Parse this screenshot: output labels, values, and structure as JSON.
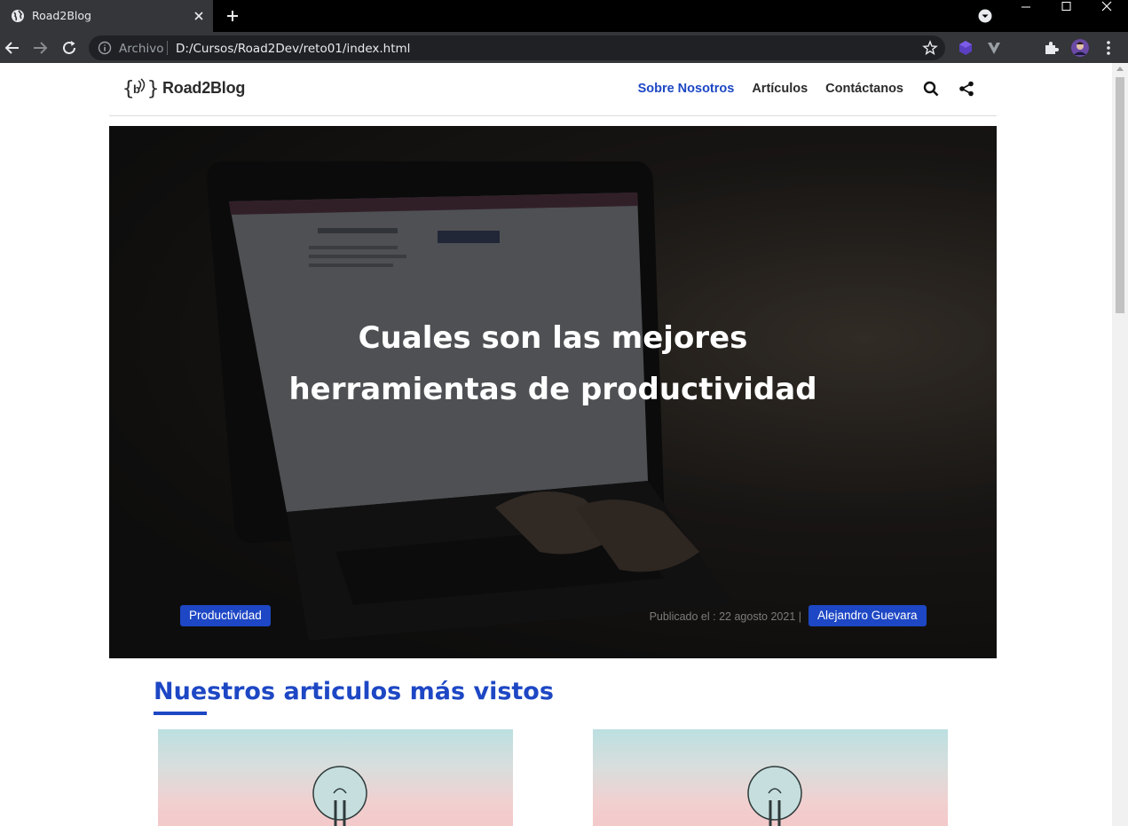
{
  "browser": {
    "tab_title": "Road2Blog",
    "omnibox_scheme_label": "Archivo",
    "url": "D:/Cursos/Road2Dev/reto01/index.html"
  },
  "site": {
    "logo_text": "Road2Blog",
    "nav": [
      {
        "label": "Sobre Nosotros",
        "active": true
      },
      {
        "label": "Artículos",
        "active": false
      },
      {
        "label": "Contáctanos",
        "active": false
      }
    ]
  },
  "hero": {
    "title": "Cuales son las mejores herramientas de productividad",
    "category": "Productividad",
    "published_label": "Publicado el : 22 agosto 2021 |",
    "author": "Alejandro Guevara"
  },
  "section": {
    "title": "Nuestros articulos más vistos"
  },
  "colors": {
    "accent": "#1d47c4",
    "chrome_dark": "#35363a",
    "omnibox": "#202124"
  },
  "icons": [
    "globe-icon",
    "close-icon",
    "plus-icon",
    "profile-dropdown-icon",
    "minimize-icon",
    "maximize-icon",
    "window-close-icon",
    "back-arrow-icon",
    "forward-arrow-icon",
    "reload-icon",
    "info-icon",
    "star-icon",
    "extension-icon",
    "puzzle-icon",
    "avatar",
    "kebab-menu-icon",
    "search-icon",
    "share-icon"
  ]
}
